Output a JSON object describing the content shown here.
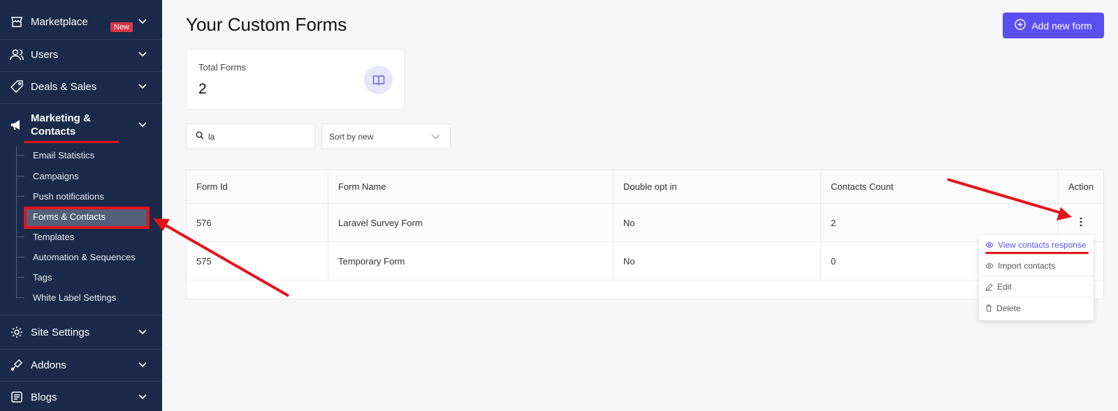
{
  "sidebar": {
    "items": [
      {
        "label": "Marketplace",
        "badge": "New"
      },
      {
        "label": "Users"
      },
      {
        "label": "Deals & Sales"
      },
      {
        "label": "Marketing &",
        "label2": "Contacts"
      },
      {
        "label": "Site Settings"
      },
      {
        "label": "Addons"
      },
      {
        "label": "Blogs"
      }
    ],
    "sub_items": [
      "Email Statistics",
      "Campaigns",
      "Push notifications",
      "Forms & Contacts",
      "Templates",
      "Automation & Sequences",
      "Tags",
      "White Label Settings"
    ]
  },
  "page": {
    "title": "Your Custom Forms",
    "add_button": "Add new form"
  },
  "stats": {
    "label": "Total Forms",
    "value": "2"
  },
  "filters": {
    "search_value": "la",
    "sort_label": "Sort by new"
  },
  "table": {
    "headers": [
      "Form Id",
      "Form Name",
      "Double opt in",
      "Contacts Count",
      "Action"
    ],
    "rows": [
      [
        "576",
        "Laravel Survey Form",
        "No",
        "2"
      ],
      [
        "575",
        "Temporary Form",
        "No",
        "0"
      ]
    ]
  },
  "action_menu": {
    "items": [
      "View contacts response",
      "Import contacts",
      "Edit",
      "Delete"
    ]
  },
  "colors": {
    "sidebar_bg": "#1b2a4a",
    "accent": "#5b4ff2",
    "annotation_red": "#e6131b"
  }
}
